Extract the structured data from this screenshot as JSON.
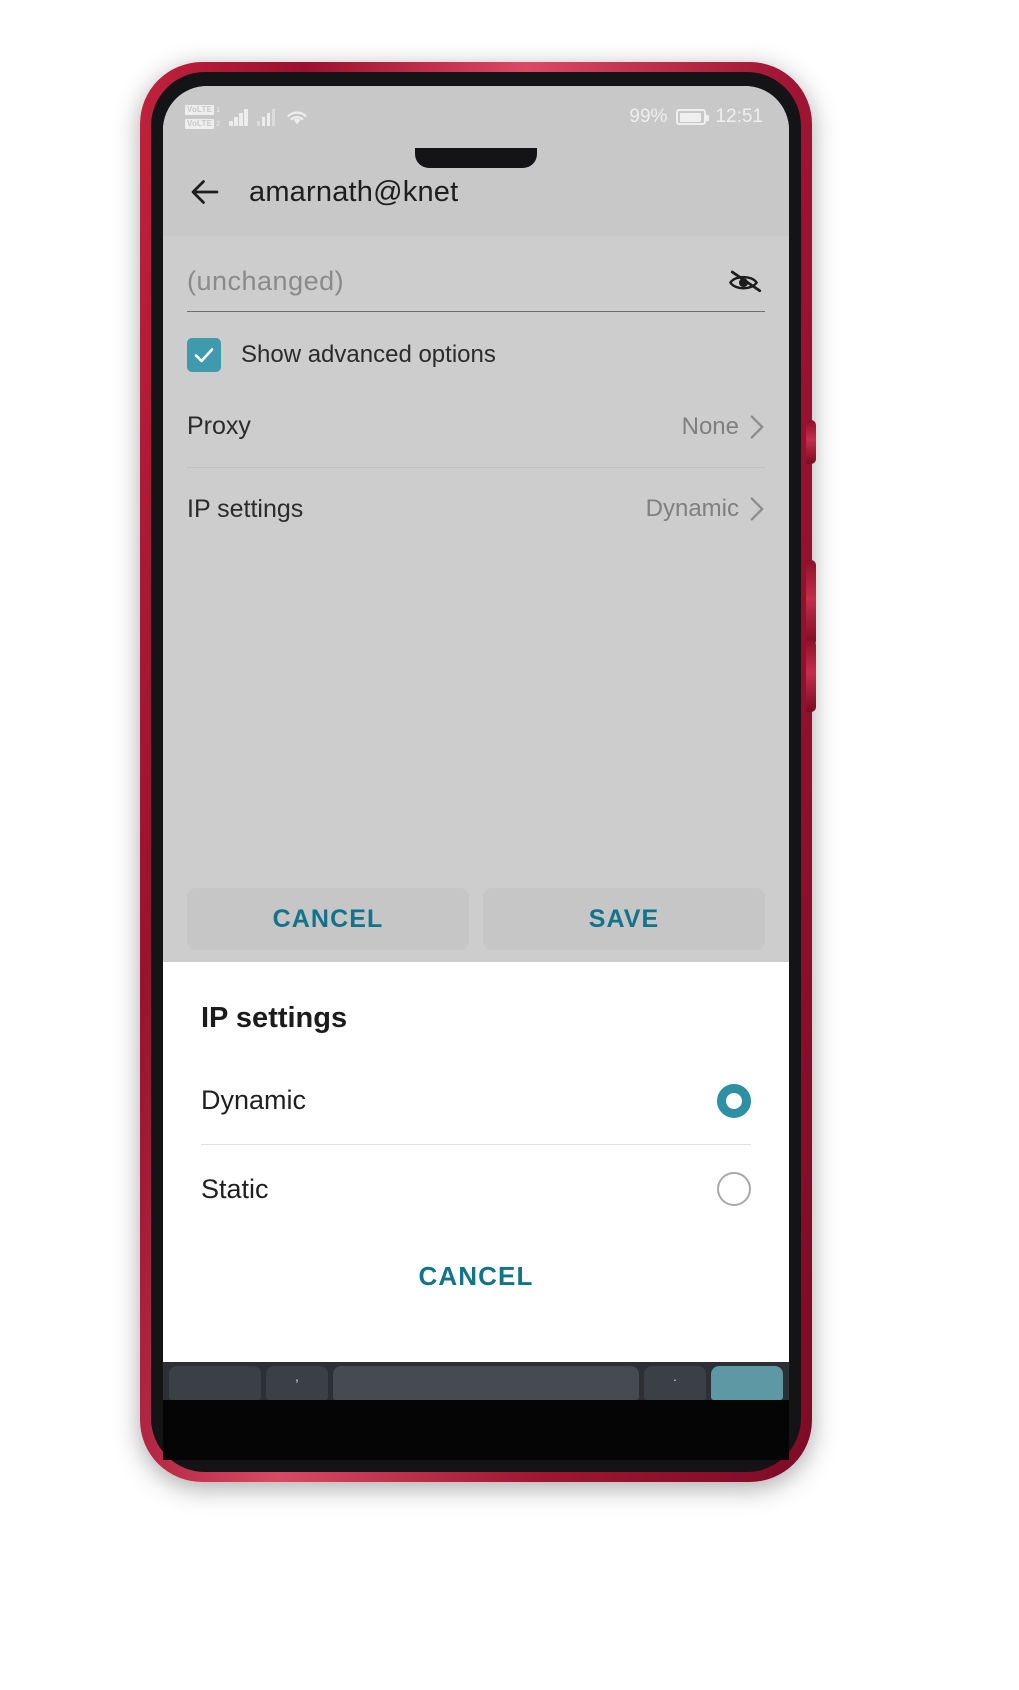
{
  "statusbar": {
    "volte1_label": "VoLTE",
    "volte1_sim": "1",
    "volte2_label": "VoLTE",
    "volte2_sim": "2",
    "battery_percent": "99%",
    "time": "12:51"
  },
  "appbar": {
    "title": "amarnath@knet",
    "back_icon": "arrow-left-icon"
  },
  "form": {
    "password_placeholder": "(unchanged)",
    "password_value": "",
    "toggle_visibility_icon": "eye-off-icon",
    "advanced_checkbox_label": "Show advanced options",
    "advanced_checkbox_checked": true,
    "rows": [
      {
        "title": "Proxy",
        "value": "None"
      },
      {
        "title": "IP settings",
        "value": "Dynamic"
      }
    ],
    "cancel_label": "CANCEL",
    "save_label": "SAVE"
  },
  "dialog": {
    "title": "IP settings",
    "options": [
      {
        "label": "Dynamic",
        "selected": true
      },
      {
        "label": "Static",
        "selected": false
      }
    ],
    "cancel_label": "CANCEL"
  },
  "keyboard": {
    "key_comma": ",",
    "key_period": "."
  },
  "navbar": {
    "back_icon": "triangle-down-icon",
    "home_icon": "circle-icon",
    "recents_icon": "square-icon",
    "keyboard_icon": "keyboard-icon"
  },
  "colors": {
    "accent_teal": "#2f90a3",
    "action_text": "#12738a",
    "checkbox_fill": "#3f9aad",
    "screen_bg": "#cdcdcd",
    "dialog_bg": "#ffffff",
    "phone_body": "#a01634"
  }
}
